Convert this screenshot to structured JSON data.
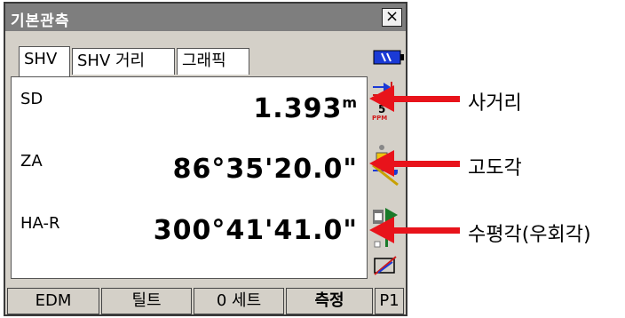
{
  "window": {
    "title": "기본관측",
    "close_label": "×"
  },
  "tabs": [
    {
      "label": "SHV",
      "active": true
    },
    {
      "label": "SHV 거리",
      "active": false
    },
    {
      "label": "그래픽",
      "active": false
    }
  ],
  "rows": [
    {
      "label": "SD",
      "value": "1.393",
      "unit": "m"
    },
    {
      "label": "ZA",
      "value": "86°35'20.0\"",
      "unit": ""
    },
    {
      "label": "HA-R",
      "value": "300°41'41.0\"",
      "unit": ""
    }
  ],
  "side_icons": {
    "ppm_value": "5",
    "ppm_label": "PPM"
  },
  "function_keys": [
    {
      "label": "EDM"
    },
    {
      "label": "틸트"
    },
    {
      "label": "0 세트"
    },
    {
      "label": "측정"
    },
    {
      "label": "P1"
    }
  ],
  "callouts": [
    {
      "label": "사거리"
    },
    {
      "label": "고도각"
    },
    {
      "label": "수평각(우회각)"
    }
  ],
  "colors": {
    "arrow": "#e8131b",
    "titlebar": "#7e7e7e",
    "battery": "#1a3ad6"
  }
}
